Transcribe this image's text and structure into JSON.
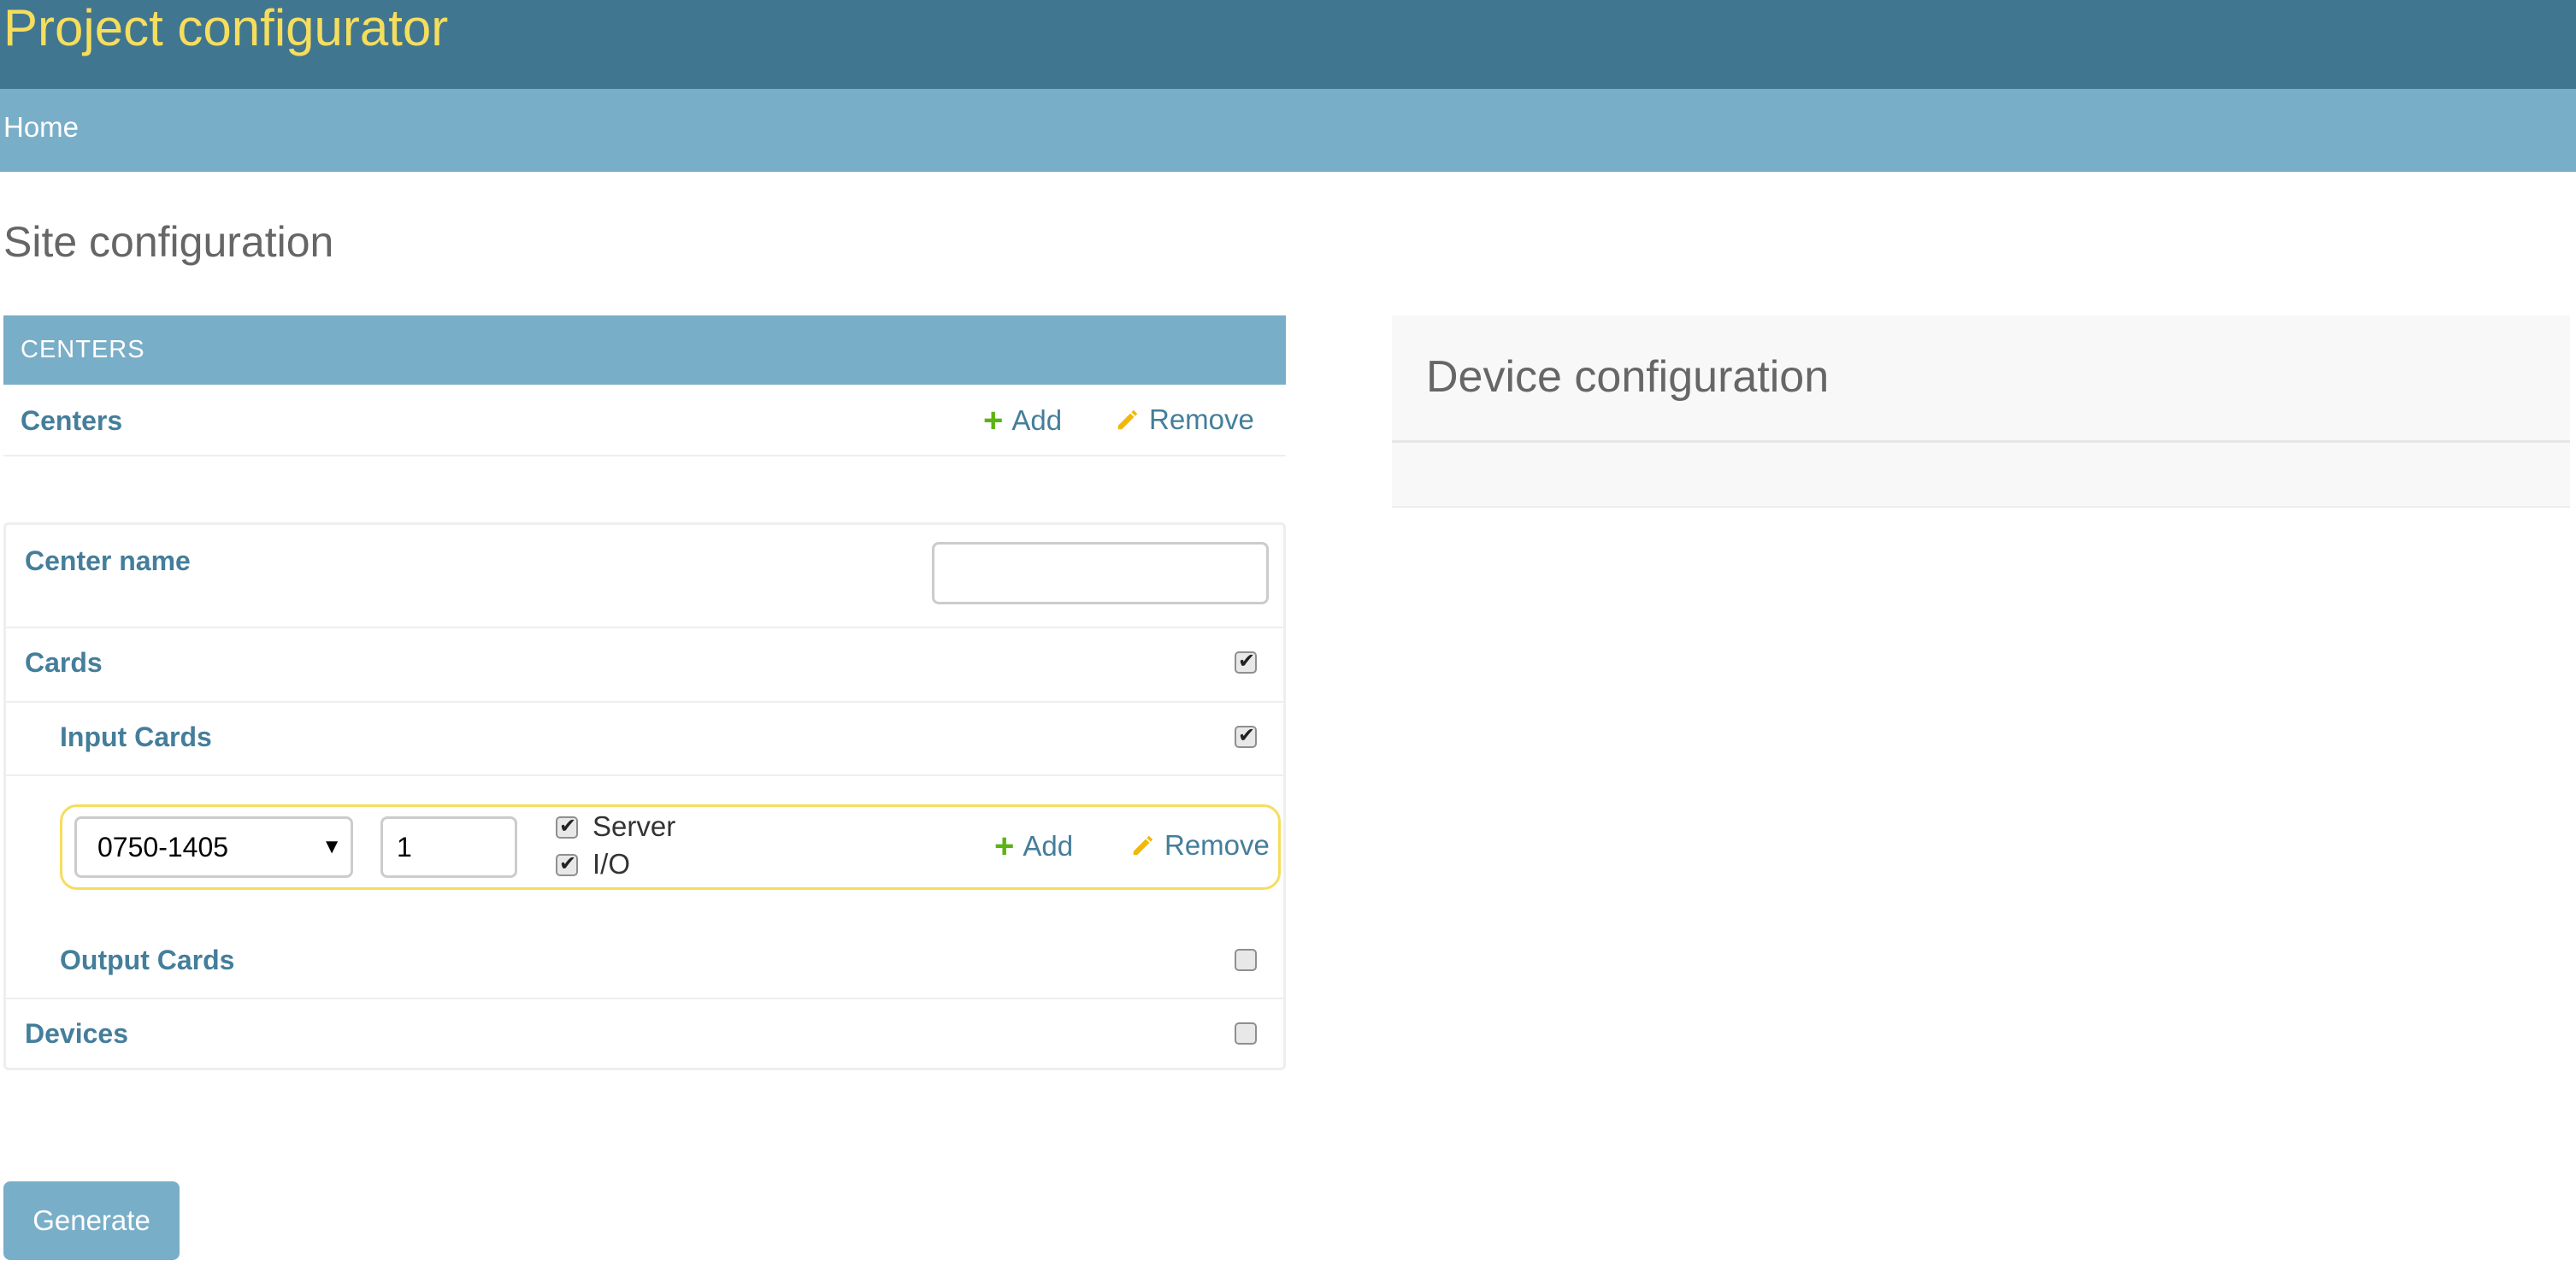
{
  "header": {
    "title": "Project configurator"
  },
  "breadcrumbs": {
    "home": "Home"
  },
  "page": {
    "title": "Site configuration"
  },
  "centers_module": {
    "caption": "CENTERS",
    "row_label": "Centers",
    "add_label": "Add",
    "remove_label": "Remove"
  },
  "form": {
    "center_name_label": "Center name",
    "center_name_value": "",
    "cards_label": "Cards",
    "cards_checked": true,
    "input_cards_label": "Input Cards",
    "input_cards_checked": true,
    "card_entry": {
      "part_number": "0750-1405",
      "quantity": "1",
      "server_label": "Server",
      "server_checked": true,
      "io_label": "I/O",
      "io_checked": true,
      "add_label": "Add",
      "remove_label": "Remove"
    },
    "output_cards_label": "Output Cards",
    "output_cards_checked": false,
    "devices_label": "Devices",
    "devices_checked": false
  },
  "device_panel": {
    "title": "Device configuration"
  },
  "actions": {
    "generate_label": "Generate"
  },
  "colors": {
    "header": "#417690",
    "breadcrumbs": "#79aec8",
    "brand_text": "#f5dd5d",
    "link": "#447e9b",
    "add_icon": "#5cb314",
    "remove_icon": "#efb80b",
    "highlight_border": "#f5dd5d"
  },
  "icons": {
    "add": "plus-icon",
    "remove": "pencil-icon",
    "select": "chevron-down-icon"
  }
}
